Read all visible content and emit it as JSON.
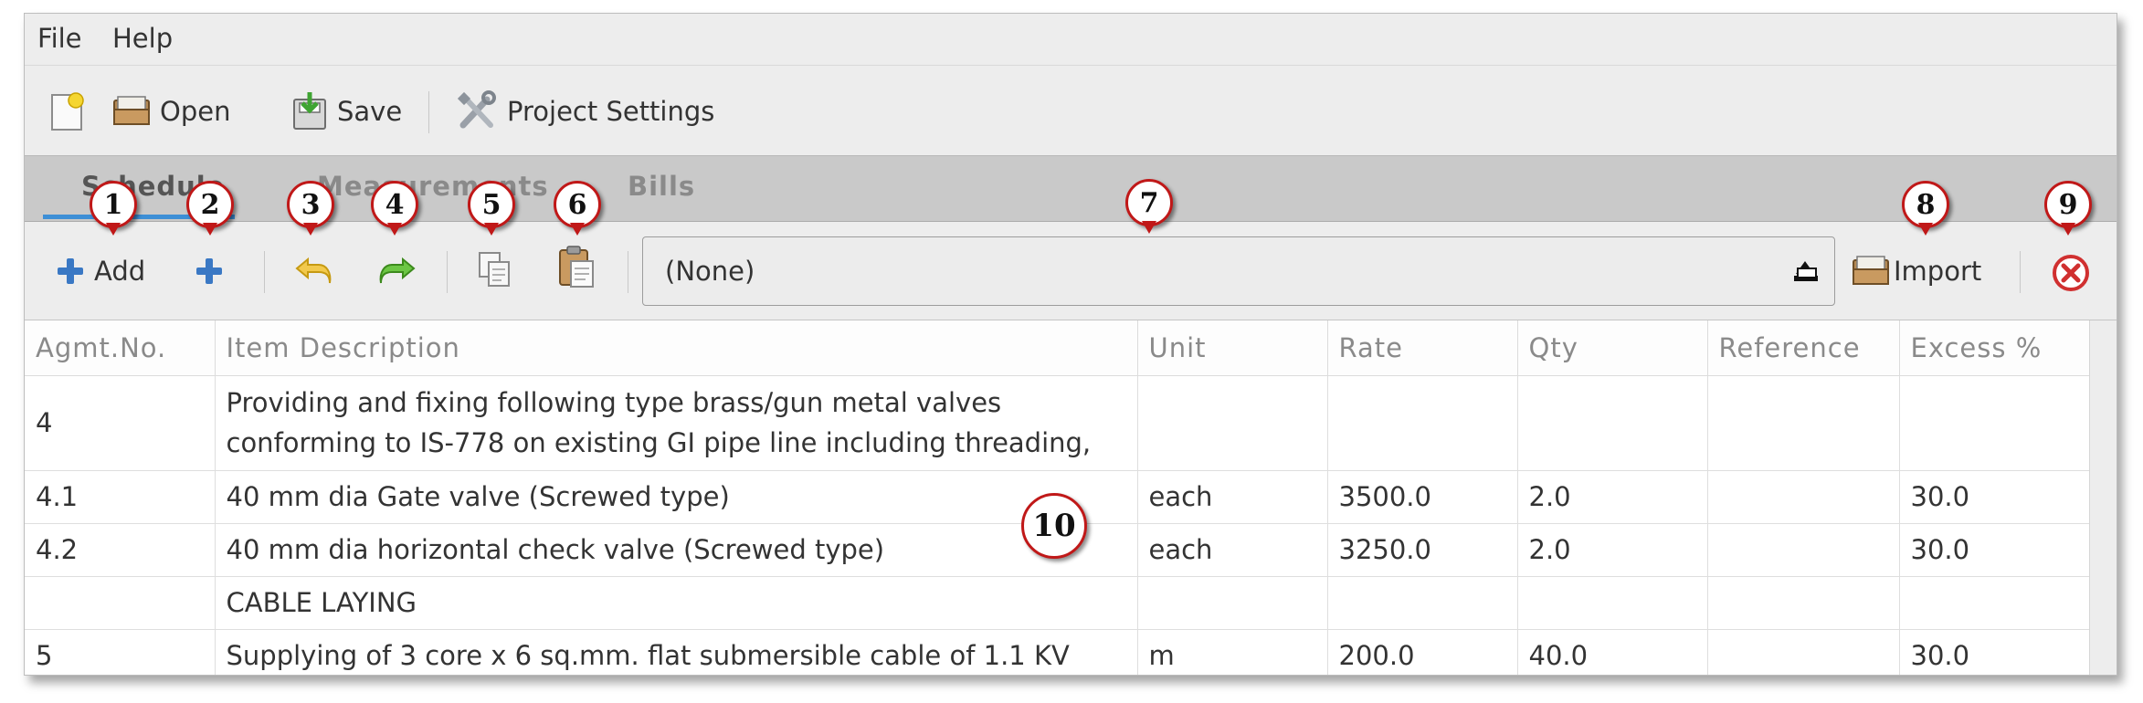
{
  "menu": {
    "file": "File",
    "help": "Help"
  },
  "toolbar": {
    "new_icon": "new-document-icon",
    "open_label": "Open",
    "save_label": "Save",
    "project_settings_label": "Project Settings"
  },
  "tabs": [
    {
      "label": "Schedule",
      "active": true
    },
    {
      "label": "Measurements",
      "active": false
    },
    {
      "label": "Bills",
      "active": false
    }
  ],
  "schedule_toolbar": {
    "add_label": "Add",
    "combo_value": "(None)",
    "import_label": "Import"
  },
  "table": {
    "columns": [
      "Agmt.No.",
      "Item Description",
      "Unit",
      "Rate",
      "Qty",
      "Reference",
      "Excess %"
    ],
    "rows": [
      {
        "agmt": "4",
        "desc1": "Providing and fixing following type brass/gun metal valves",
        "desc2": "conforming to IS-778 on existing GI pipe line including threading,",
        "unit": "",
        "rate": "",
        "qty": "",
        "ref": "",
        "excess": ""
      },
      {
        "agmt": "4.1",
        "desc": "40 mm dia Gate valve (Screwed type)",
        "unit": "each",
        "rate": "3500.0",
        "qty": "2.0",
        "ref": "",
        "excess": "30.0"
      },
      {
        "agmt": "4.2",
        "desc": "40 mm dia horizontal check valve (Screwed type)",
        "unit": "each",
        "rate": "3250.0",
        "qty": "2.0",
        "ref": "",
        "excess": "30.0"
      },
      {
        "agmt": "",
        "desc": "CABLE LAYING",
        "unit": "",
        "rate": "",
        "qty": "",
        "ref": "",
        "excess": ""
      },
      {
        "agmt": "5",
        "desc": "Supplying of 3 core x 6 sq.mm. flat submersible cable of 1.1 KV",
        "unit": "m",
        "rate": "200.0",
        "qty": "40.0",
        "ref": "",
        "excess": "30.0"
      }
    ]
  },
  "callouts": [
    "1",
    "2",
    "3",
    "4",
    "5",
    "6",
    "7",
    "8",
    "9",
    "10"
  ],
  "colors": {
    "callout_border": "#c01818",
    "tab_underline": "#3d8fd6",
    "add_icon": "#3a78c4",
    "undo_icon": "#e0b020",
    "redo_icon": "#4caf2a",
    "close_icon": "#d03030"
  }
}
